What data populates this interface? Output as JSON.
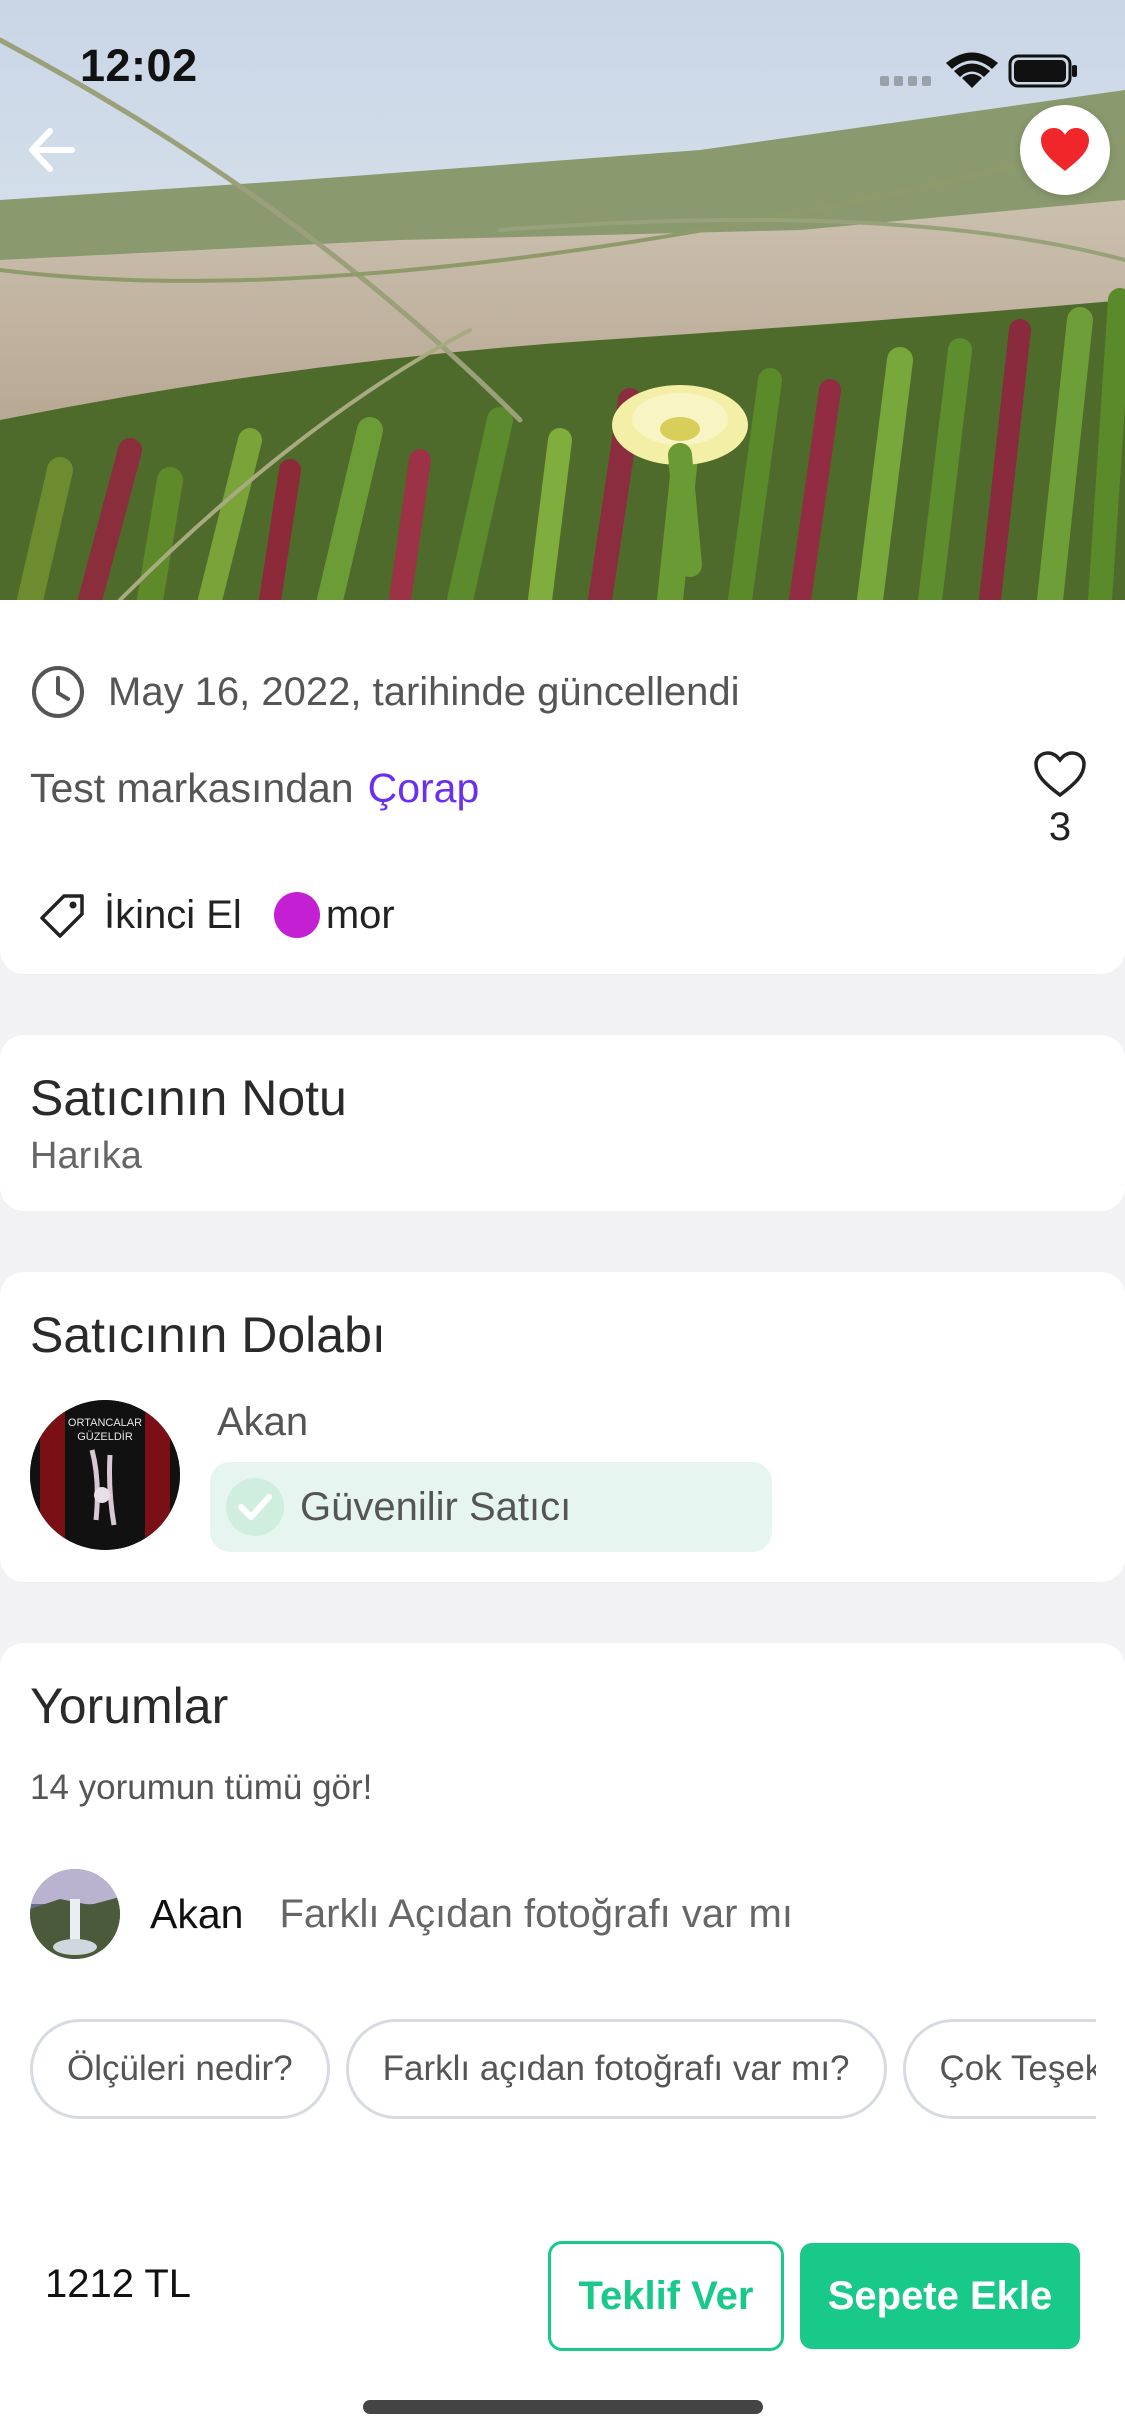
{
  "status_bar": {
    "time": "12:02"
  },
  "product": {
    "updated_text": "May 16, 2022, tarihinde güncellendi",
    "brand_text": "Test markasından",
    "category": "Çorap",
    "likes": "3",
    "condition": "İkinci El",
    "color_name": "mor",
    "color_hex": "#c41fd3"
  },
  "seller_note": {
    "title": "Satıcının Notu",
    "text": "Harıka"
  },
  "seller_closet": {
    "title": "Satıcının Dolabı",
    "seller_name": "Akan",
    "badge": "Güvenilir Satıcı",
    "avatar_caption_1": "ORTANCALAR",
    "avatar_caption_2": "GÜZELDİR"
  },
  "comments": {
    "title": "Yorumlar",
    "see_all": "14 yorumun tümü gör!",
    "latest": {
      "user": "Akan",
      "text": "Farklı Açıdan fotoğrafı var mı"
    },
    "quick_replies": [
      "Ölçüleri nedir?",
      "Farklı açıdan fotoğrafı var mı?",
      "Çok Teşekkürler"
    ]
  },
  "footer": {
    "price": "1212 TL",
    "offer_label": "Teklif Ver",
    "cart_label": "Sepete Ekle"
  },
  "colors": {
    "accent_green": "#19c98a",
    "accent_purple": "#6a2ff0",
    "favorite_red": "#f0262a"
  }
}
